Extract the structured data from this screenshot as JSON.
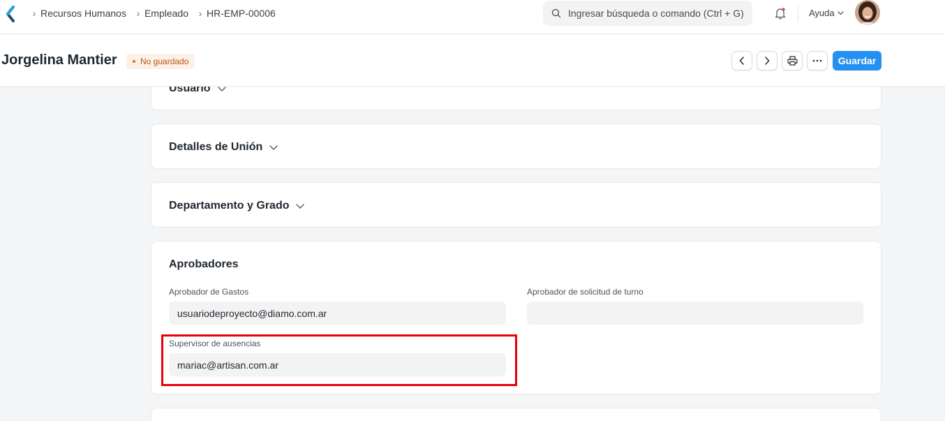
{
  "navbar": {
    "breadcrumbs": [
      "Recursos Humanos",
      "Empleado",
      "HR-EMP-00006"
    ],
    "search_placeholder": "Ingresar búsqueda o comando (Ctrl + G)",
    "help_label": "Ayuda",
    "icons": {
      "logo": "app-logo-icon",
      "search": "search-icon",
      "notifications": "bell-icon",
      "dropdown": "chevron-down-icon"
    }
  },
  "header": {
    "title": "Jorgelina Mantier",
    "status_badge": "No guardado",
    "save_label": "Guardar",
    "icons": {
      "prev": "chevron-left-icon",
      "next": "chevron-right-icon",
      "print": "printer-icon",
      "more": "more-icon"
    }
  },
  "sections": {
    "usuario": "Usuario",
    "union": "Detalles de Unión",
    "departamento": "Departamento y Grado",
    "aprobadores": {
      "title": "Aprobadores",
      "expense_label": "Aprobador de Gastos",
      "expense_value": "usuariodeproyecto@diamo.com.ar",
      "shift_label": "Aprobador de solicitud de turno",
      "shift_value": "",
      "leave_label": "Supervisor de ausencias",
      "leave_value": "mariac@artisan.com.ar"
    }
  },
  "colors": {
    "primary": "#2490ef",
    "highlight_box": "#e8000b",
    "badge_text": "#b8531a",
    "badge_bg": "#fdf0e6"
  }
}
